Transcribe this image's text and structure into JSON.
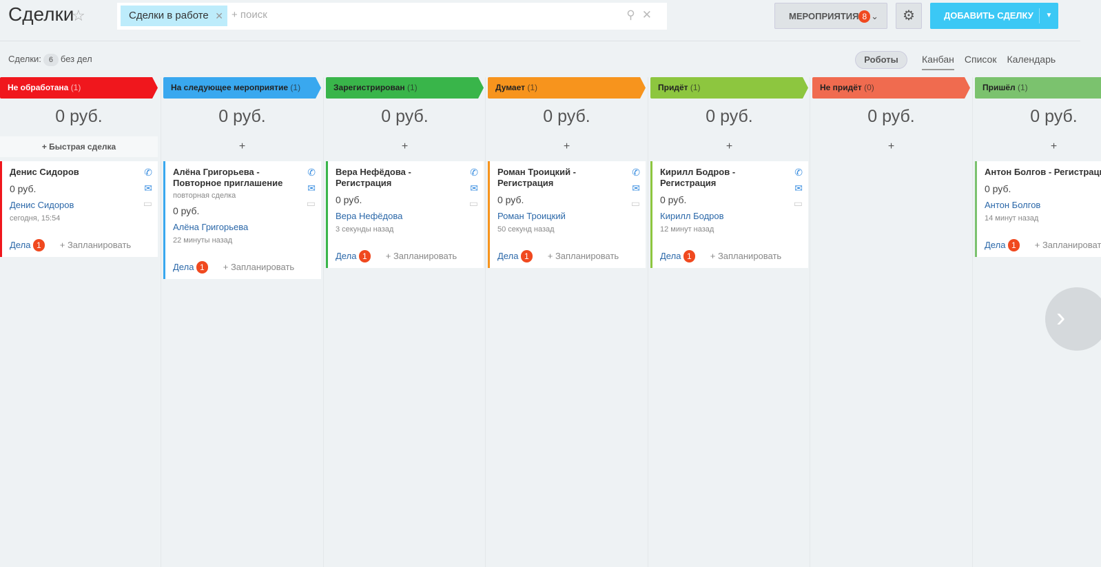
{
  "header": {
    "title": "Сделки",
    "filter_chip": "Сделки в работе",
    "search_placeholder": "+ поиск",
    "events_label": "МЕРОПРИЯТИЯ",
    "events_count": "8",
    "add_label": "ДОБАВИТЬ СДЕЛКУ"
  },
  "toolbar": {
    "deals_label": "Сделки:",
    "deals_count": "6",
    "no_tasks": "без дел",
    "robots": "Роботы",
    "views": [
      "Канбан",
      "Список",
      "Календарь"
    ]
  },
  "columns": [
    {
      "stage": "Не обработана",
      "count": "(1)",
      "color": "#f0171d",
      "text": "#fff",
      "sum": "0 руб.",
      "add": "+ Быстрая сделка",
      "card": {
        "name": "Денис Сидоров",
        "sub": "",
        "price": "0 руб.",
        "contact": "Денис Сидоров",
        "time": "сегодня, 15:54",
        "tasks": "Дела",
        "tasks_count": "1",
        "plan": "+ Запланировать"
      }
    },
    {
      "stage": "На следующее мероприятие",
      "count": "(1)",
      "color": "#39a8ef",
      "text": "#222",
      "sum": "0 руб.",
      "add": "+",
      "card": {
        "name": "Алёна Григорьева - Повторное приглашение",
        "sub": "повторная сделка",
        "price": "0 руб.",
        "contact": "Алёна Григорьева",
        "time": "22 минуты назад",
        "tasks": "Дела",
        "tasks_count": "1",
        "plan": "+ Запланировать"
      }
    },
    {
      "stage": "Зарегистрирован",
      "count": "(1)",
      "color": "#39b54a",
      "text": "#222",
      "sum": "0 руб.",
      "add": "+",
      "card": {
        "name": "Вера Нефёдова - Регистрация",
        "sub": "",
        "price": "0 руб.",
        "contact": "Вера Нефёдова",
        "time": "3 секунды назад",
        "tasks": "Дела",
        "tasks_count": "1",
        "plan": "+ Запланировать"
      }
    },
    {
      "stage": "Думает",
      "count": "(1)",
      "color": "#f7941d",
      "text": "#222",
      "sum": "0 руб.",
      "add": "+",
      "card": {
        "name": "Роман Троицкий - Регистрация",
        "sub": "",
        "price": "0 руб.",
        "contact": "Роман Троицкий",
        "time": "50 секунд назад",
        "tasks": "Дела",
        "tasks_count": "1",
        "plan": "+ Запланировать"
      }
    },
    {
      "stage": "Придёт",
      "count": "(1)",
      "color": "#8dc63f",
      "text": "#222",
      "sum": "0 руб.",
      "add": "+",
      "card": {
        "name": "Кирилл Бодров - Регистрация",
        "sub": "",
        "price": "0 руб.",
        "contact": "Кирилл Бодров",
        "time": "12 минут назад",
        "tasks": "Дела",
        "tasks_count": "1",
        "plan": "+ Запланировать"
      }
    },
    {
      "stage": "Не придёт",
      "count": "(0)",
      "color": "#f06b4f",
      "text": "#222",
      "sum": "0 руб.",
      "add": "+"
    },
    {
      "stage": "Пришёл",
      "count": "(1)",
      "color": "#7bc26e",
      "text": "#222",
      "sum": "0 руб.",
      "add": "+",
      "card": {
        "name": "Антон Болгов - Регистрация",
        "sub": "",
        "price": "0 руб.",
        "contact": "Антон Болгов",
        "time": "14 минут назад",
        "tasks": "Дела",
        "tasks_count": "1",
        "plan": "+ Запланировать"
      }
    }
  ]
}
